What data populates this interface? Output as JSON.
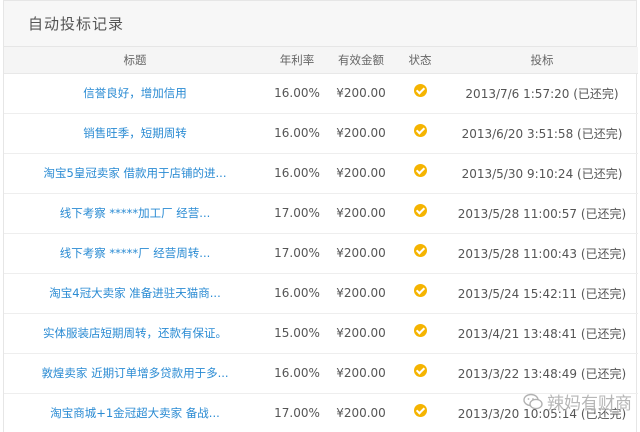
{
  "panel": {
    "title": "自动投标记录"
  },
  "table": {
    "headers": {
      "title": "标题",
      "rate": "年利率",
      "amount": "有效金额",
      "status": "状态",
      "time": "投标"
    },
    "rows": [
      {
        "title": "信誉良好，增加信用",
        "rate": "16.00%",
        "amount": "¥200.00",
        "status_icon": "check-circle-icon",
        "time": "2013/7/6 1:57:20 (已还完)"
      },
      {
        "title": "销售旺季，短期周转",
        "rate": "16.00%",
        "amount": "¥200.00",
        "status_icon": "check-circle-icon",
        "time": "2013/6/20 3:51:58 (已还完)"
      },
      {
        "title": "淘宝5皇冠卖家 借款用于店铺的进...",
        "rate": "16.00%",
        "amount": "¥200.00",
        "status_icon": "check-circle-icon",
        "time": "2013/5/30 9:10:24 (已还完)"
      },
      {
        "title": "线下考察 *****加工厂 经营...",
        "rate": "17.00%",
        "amount": "¥200.00",
        "status_icon": "check-circle-icon",
        "time": "2013/5/28 11:00:57 (已还完)"
      },
      {
        "title": "线下考察 *****厂 经营周转...",
        "rate": "17.00%",
        "amount": "¥200.00",
        "status_icon": "check-circle-icon",
        "time": "2013/5/28 11:00:43 (已还完)"
      },
      {
        "title": "淘宝4冠大卖家 准备进驻天猫商...",
        "rate": "16.00%",
        "amount": "¥200.00",
        "status_icon": "check-circle-icon",
        "time": "2013/5/24 15:42:11 (已还完)"
      },
      {
        "title": "实体服装店短期周转，还款有保证。",
        "rate": "15.00%",
        "amount": "¥200.00",
        "status_icon": "check-circle-icon",
        "time": "2013/4/21 13:48:41 (已还完)"
      },
      {
        "title": "敦煌卖家 近期订单增多贷款用于多...",
        "rate": "16.00%",
        "amount": "¥200.00",
        "status_icon": "check-circle-icon",
        "time": "2013/3/22 13:48:49 (已还完)"
      },
      {
        "title": "淘宝商城+1金冠超大卖家 备战...",
        "rate": "17.00%",
        "amount": "¥200.00",
        "status_icon": "check-circle-icon",
        "time": "2013/3/20 10:05:14 (已还完)"
      }
    ]
  },
  "watermark": {
    "text": "辣妈有财商",
    "icon": "wechat-icon"
  },
  "colors": {
    "link": "#2a8bd3",
    "check": "#f5b400",
    "header_bg": "#f7f7f7"
  }
}
